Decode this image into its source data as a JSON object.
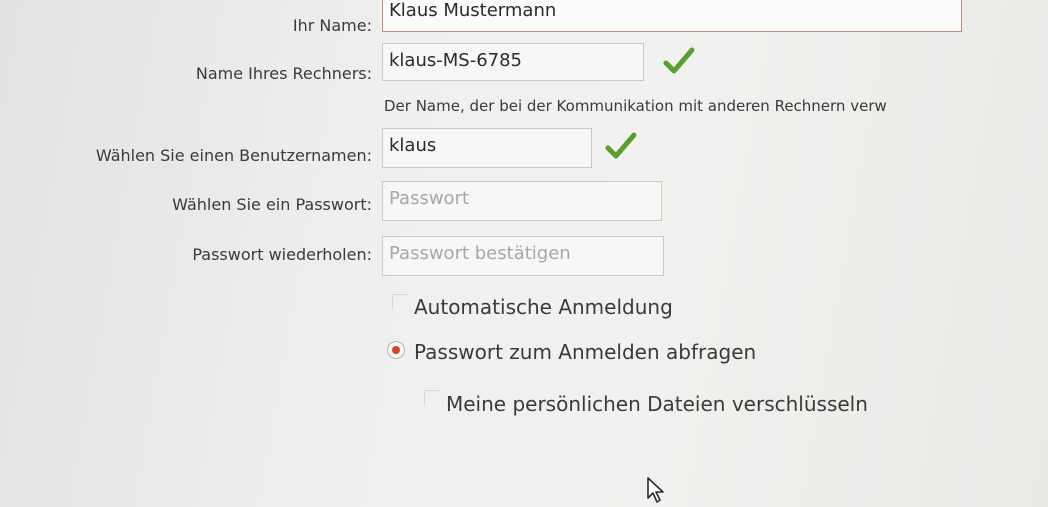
{
  "form": {
    "name": {
      "label": "Ihr Name:",
      "value": "Klaus Mustermann"
    },
    "computer": {
      "label": "Name Ihres Rechners:",
      "value": "klaus-MS-6785",
      "hint": "Der Name, der bei der Kommunikation mit anderen Rechnern verw"
    },
    "username": {
      "label": "Wählen Sie einen Benutzernamen:",
      "value": "klaus"
    },
    "password": {
      "label": "Wählen Sie ein Passwort:",
      "placeholder": "Passwort"
    },
    "confirm": {
      "label": "Passwort wiederholen:",
      "placeholder": "Passwort bestätigen"
    }
  },
  "options": {
    "auto_login": {
      "label": "Automatische Anmeldung",
      "checked": false
    },
    "ask_password": {
      "label": "Passwort zum Anmelden abfragen",
      "selected": true
    },
    "encrypt_home": {
      "label": "Meine persönlichen Dateien verschlüsseln",
      "checked": false
    }
  },
  "icons": {
    "valid": "check-mark-icon",
    "cursor": "mouse-pointer-icon"
  },
  "colors": {
    "valid_green": "#5a9e2f",
    "radio_selected": "#d2472c",
    "focus_border": "#c98a7e"
  }
}
